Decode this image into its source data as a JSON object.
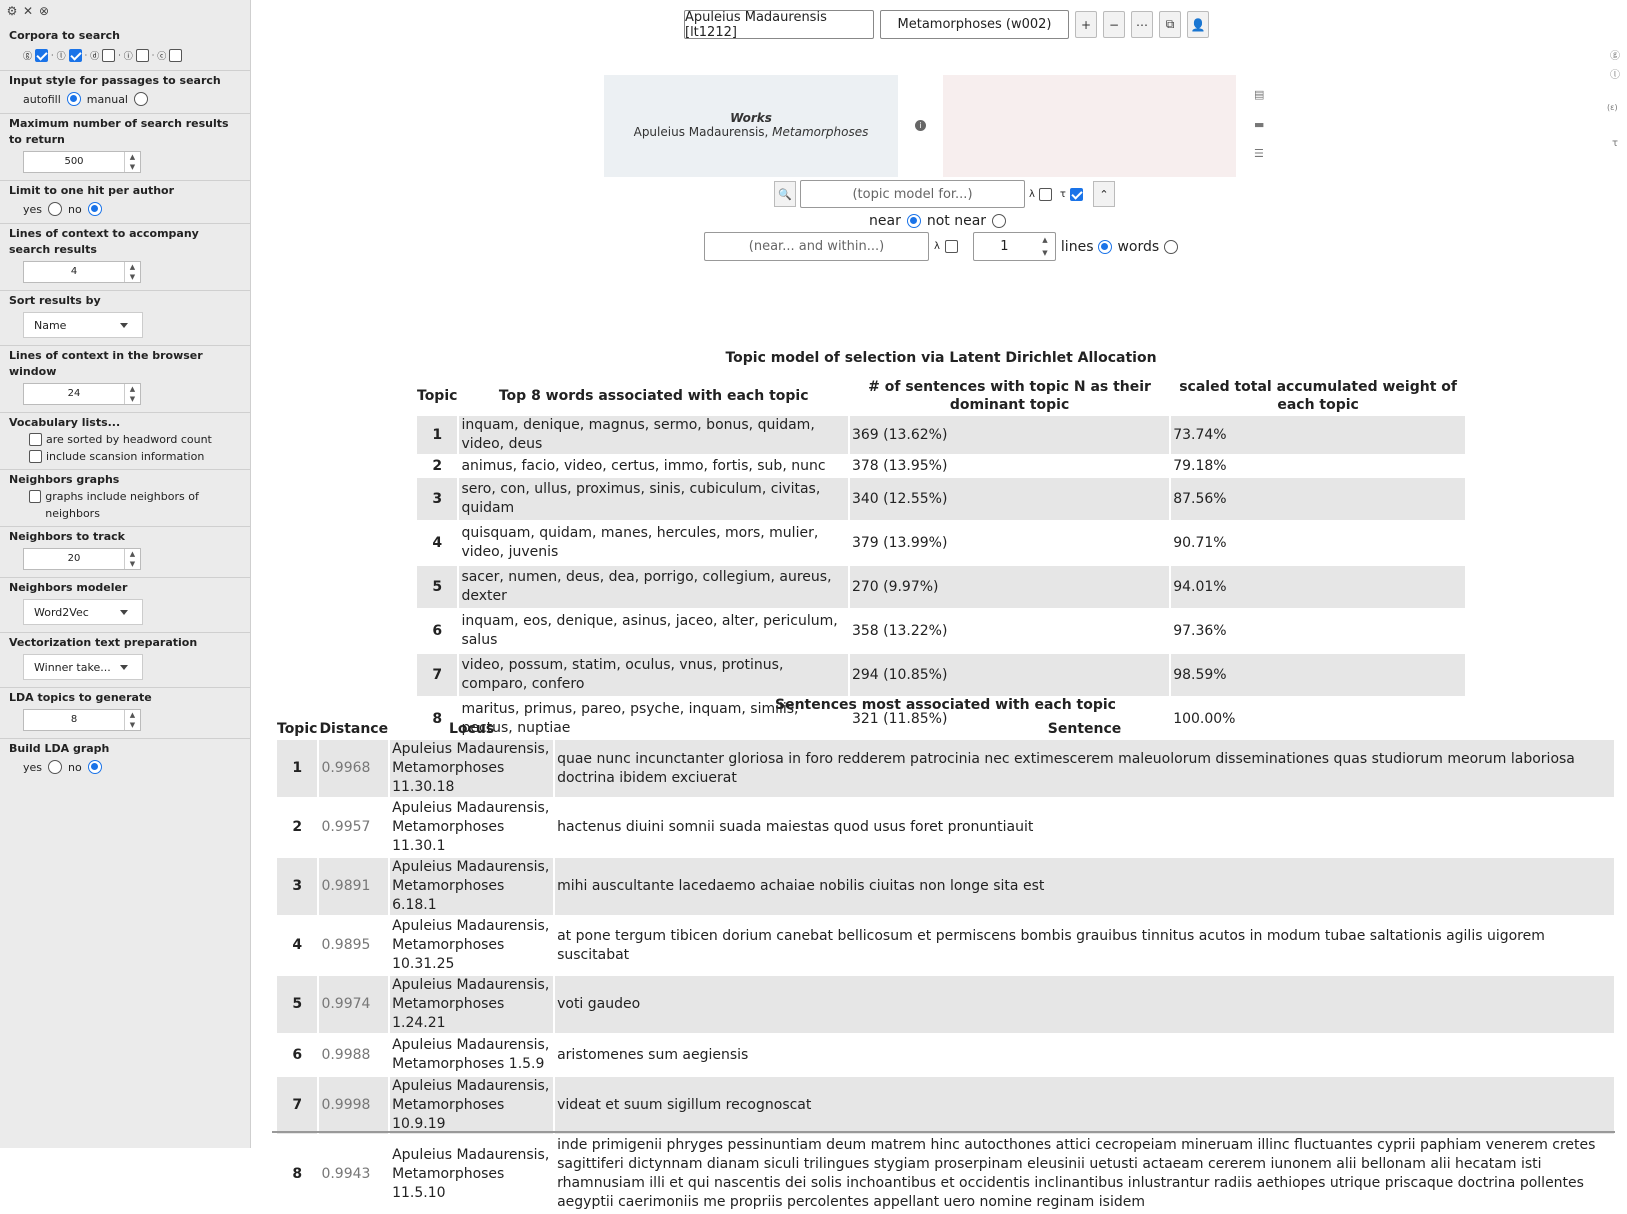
{
  "sidebar": {
    "sections": {
      "corpora": {
        "heading": "Corpora to search",
        "items": [
          "ⓖ",
          "ⓛ",
          "ⓓ",
          "ⓘ",
          "ⓒ"
        ]
      },
      "input_style": {
        "heading": "Input style for passages to search",
        "opt1": "autofill",
        "opt2": "manual"
      },
      "max_results": {
        "heading": "Maximum number of search results to return",
        "value": "500"
      },
      "one_hit": {
        "heading": "Limit to one hit per author",
        "opt1": "yes",
        "opt2": "no"
      },
      "lines_context": {
        "heading": "Lines of context to accompany search results",
        "value": "4"
      },
      "sort": {
        "heading": "Sort results by",
        "value": "Name"
      },
      "browser_lines": {
        "heading": "Lines of context in the browser window",
        "value": "24"
      },
      "vocab": {
        "heading": "Vocabulary lists...",
        "opt1": "are sorted by headword count",
        "opt2": "include scansion information"
      },
      "neighbors_graphs": {
        "heading": "Neighbors graphs",
        "opt1": "graphs include neighbors of neighbors"
      },
      "neighbors_track": {
        "heading": "Neighbors to track",
        "value": "20"
      },
      "neighbors_modeler": {
        "heading": "Neighbors modeler",
        "value": "Word2Vec"
      },
      "vector_prep": {
        "heading": "Vectorization text preparation",
        "value": "Winner take..."
      },
      "lda_topics": {
        "heading": "LDA topics to generate",
        "value": "8"
      },
      "build_lda": {
        "heading": "Build LDA graph",
        "opt1": "yes",
        "opt2": "no"
      }
    }
  },
  "topbar": {
    "author": "Apuleius Madaurensis [lt1212]",
    "work": "Metamorphoses (w002)",
    "buttons": [
      "+",
      "−",
      "⋯",
      "⧉",
      "👤"
    ]
  },
  "selection": {
    "heading": "Works",
    "author": "Apuleius Madaurensis, ",
    "work": "Metamorphoses"
  },
  "search": {
    "topic_placeholder": "(topic model for...)",
    "lambda": "λ",
    "tau": "τ",
    "near": "near",
    "not_near": "not near",
    "within_placeholder": "(near... and within...)",
    "within_value": "1",
    "lines": "lines",
    "words": "words"
  },
  "topic_table": {
    "title": "Topic model of selection via Latent Dirichlet Allocation",
    "headers": [
      "Topic",
      "Top 8 words associated with each topic",
      "# of sentences with topic N as their dominant topic",
      "scaled total accumulated weight of each topic"
    ],
    "rows": [
      [
        "1",
        "inquam, denique, magnus, sermo, bonus, quidam, video, deus",
        "369 (13.62%)",
        "73.74%"
      ],
      [
        "2",
        "animus, facio, video, certus, immo, fortis, sub, nunc",
        "378 (13.95%)",
        "79.18%"
      ],
      [
        "3",
        "sero, con, ullus, proximus, sinis, cubiculum, civitas, quidam",
        "340 (12.55%)",
        "87.56%"
      ],
      [
        "4",
        "quisquam, quidam, manes, hercules, mors, mulier, video, juvenis",
        "379 (13.99%)",
        "90.71%"
      ],
      [
        "5",
        "sacer, numen, deus, dea, porrigo, collegium, aureus, dexter",
        "270 (9.97%)",
        "94.01%"
      ],
      [
        "6",
        "inquam, eos, denique, asinus, jaceo, alter, periculum, salus",
        "358 (13.22%)",
        "97.36%"
      ],
      [
        "7",
        "video, possum, statim, oculus, vnus, protinus, comparo, confero",
        "294 (10.85%)",
        "98.59%"
      ],
      [
        "8",
        "maritus, primus, pareo, psyche, inquam, similis, pectus, nuptiae",
        "321 (11.85%)",
        "100.00%"
      ]
    ]
  },
  "sentence_table": {
    "title": "Sentences most associated with each topic",
    "headers": [
      "Topic",
      "Distance",
      "Locus",
      "Sentence"
    ],
    "rows": [
      [
        "1",
        "0.9968",
        "Apuleius Madaurensis, Metamorphoses 11.30.18",
        "quae nunc incunctanter gloriosa in foro redderem patrocinia nec extimescerem maleuolorum disseminationes quas studiorum meorum laboriosa doctrina ibidem exciuerat"
      ],
      [
        "2",
        "0.9957",
        "Apuleius Madaurensis, Metamorphoses 11.30.1",
        "hactenus diuini somnii suada maiestas quod usus foret pronuntiauit"
      ],
      [
        "3",
        "0.9891",
        "Apuleius Madaurensis, Metamorphoses 6.18.1",
        "mihi auscultante lacedaemo achaiae nobilis ciuitas non longe sita est"
      ],
      [
        "4",
        "0.9895",
        "Apuleius Madaurensis, Metamorphoses 10.31.25",
        "at pone tergum tibicen dorium canebat bellicosum et permiscens bombis grauibus tinnitus acutos in modum tubae saltationis agilis uigorem suscitabat"
      ],
      [
        "5",
        "0.9974",
        "Apuleius Madaurensis, Metamorphoses 1.24.21",
        "voti gaudeo"
      ],
      [
        "6",
        "0.9988",
        "Apuleius Madaurensis, Metamorphoses 1.5.9",
        "aristomenes sum aegiensis"
      ],
      [
        "7",
        "0.9998",
        "Apuleius Madaurensis, Metamorphoses 10.9.19",
        "videat et suum sigillum recognoscat"
      ],
      [
        "8",
        "0.9943",
        "Apuleius Madaurensis, Metamorphoses 11.5.10",
        "inde primigenii phryges pessinuntiam deum matrem hinc autocthones attici cecropeiam mineruam illinc fluctuantes cyprii paphiam venerem cretes sagittiferi dictynnam dianam siculi trilingues stygiam proserpinam eleusinii uetusti actaeam cererem iunonem alii bellonam alii hecatam isti rhamnusiam illi et qui nascentis dei solis inchoantibus et occidentis inclinantibus inlustrantur radiis aethiopes utrique priscaque doctrina pollentes aegyptii caerimoniis me propriis percolentes appellant uero nomine reginam isidem"
      ]
    ]
  },
  "right_icons": [
    "ⓖ",
    "ⓛ",
    "(ε)",
    "τ"
  ],
  "colors": {
    "accent": "#1a73e8",
    "sidebar_bg": "#ebebeb",
    "row_bg": "#e6e6e6",
    "works_bg": "#ecf0f3",
    "pink_bg": "#f7eeee"
  }
}
